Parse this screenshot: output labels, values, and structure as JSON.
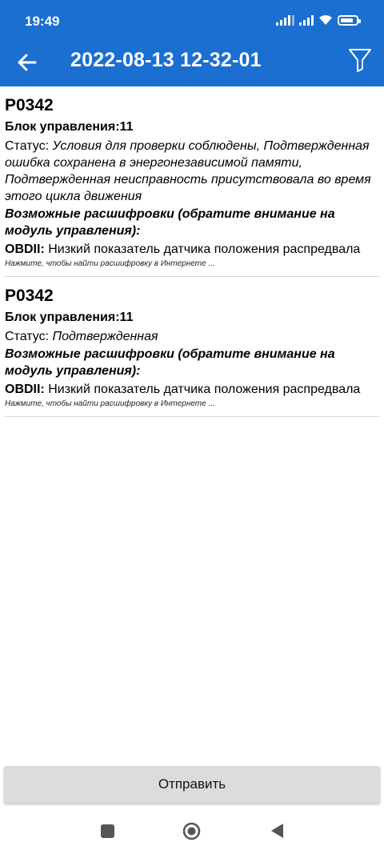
{
  "status_bar": {
    "time": "19:49"
  },
  "app_bar": {
    "title": "2022-08-13 12-32-01"
  },
  "entries": [
    {
      "code": "P0342",
      "block": "Блок управления:11",
      "status_label": "Статус: ",
      "status_value": "Условия для проверки соблюдены, Подтвержденная ошибка сохранена в энергонезависимой памяти, Подтвержденная неисправность присутствовала во время этого цикла движения",
      "possible": "Возможные расшифровки (обратите внимание на модуль управления):",
      "obd_label": "OBDII:",
      "obd_text": " Низкий показатель датчика положения распредвала",
      "hint": "Нажмите, чтобы найти расшифровку в Интернете ..."
    },
    {
      "code": "P0342",
      "block": "Блок управления:11",
      "status_label": "Статус: ",
      "status_value": "Подтвержденная",
      "possible": "Возможные расшифровки (обратите внимание на модуль управления):",
      "obd_label": "OBDII:",
      "obd_text": " Низкий показатель датчика положения распредвала",
      "hint": "Нажмите, чтобы найти расшифровку в Интернете ..."
    }
  ],
  "send_button": {
    "label": "Отправить"
  },
  "colors": {
    "app_bar": "#1a6fd0",
    "button": "#dcdcdc"
  }
}
